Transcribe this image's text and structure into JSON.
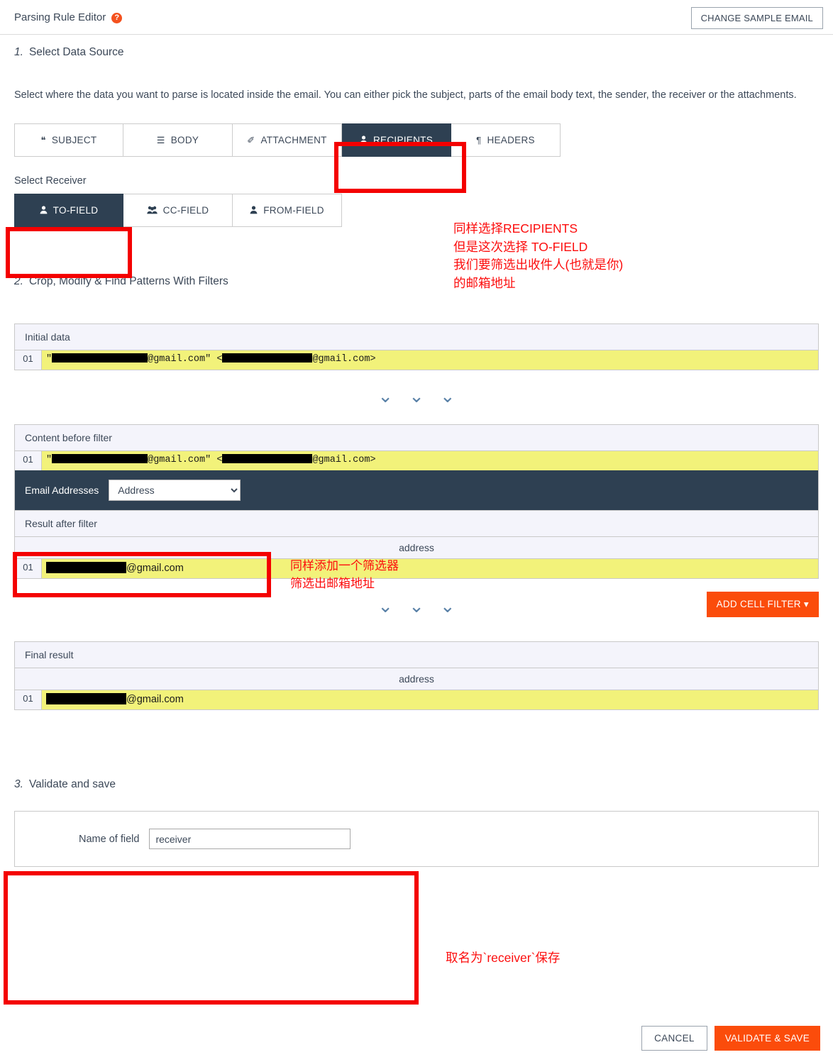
{
  "header": {
    "title": "Parsing Rule Editor",
    "help_icon": "question-mark-icon",
    "change_sample_button": "CHANGE SAMPLE EMAIL"
  },
  "step1": {
    "number": "1.",
    "title": "Select Data Source",
    "description": "Select where the data you want to parse is located inside the email. You can either pick the subject, parts of the email body text, the sender, the receiver or the attachments.",
    "source_tabs": [
      {
        "label": "SUBJECT",
        "icon": "quote-icon",
        "glyph": "❝",
        "active": false
      },
      {
        "label": "BODY",
        "icon": "lines-icon",
        "glyph": "☰",
        "active": false
      },
      {
        "label": "ATTACHMENT",
        "icon": "paperclip-icon",
        "glyph": "✐",
        "active": false
      },
      {
        "label": "RECIPIENTS",
        "icon": "user-icon",
        "glyph": "♟",
        "active": true
      },
      {
        "label": "HEADERS",
        "icon": "pilcrow-icon",
        "glyph": "¶",
        "active": false
      }
    ],
    "receiver_label": "Select Receiver",
    "receiver_tabs": [
      {
        "label": "TO-FIELD",
        "icon": "user-icon",
        "glyph": "♟",
        "active": true
      },
      {
        "label": "CC-FIELD",
        "icon": "users-group-icon",
        "glyph": "♟♟",
        "active": false
      },
      {
        "label": "FROM-FIELD",
        "icon": "user-icon",
        "glyph": "♟",
        "active": false
      }
    ],
    "annotation": "同样选择RECIPIENTS\n但是这次选择 TO-FIELD\n我们要筛选出收件人(也就是你)\n的邮箱地址"
  },
  "step2": {
    "number": "2.",
    "title": "Crop, Modify & Find Patterns With Filters",
    "initial_data": {
      "panel_title": "Initial data",
      "row_number": "01",
      "text_before": "\"",
      "text_mid": "@gmail.com\"  <",
      "text_after": "@gmail.com>"
    },
    "content_before_filter": {
      "panel_title": "Content before filter",
      "row_number": "01",
      "text_before": "\"",
      "text_mid": "@gmail.com\"  <",
      "text_after": "@gmail.com>"
    },
    "filter": {
      "label": "Email Addresses",
      "selected_option": "Address",
      "options": [
        "Address"
      ],
      "annotation": "同样添加一个筛选器\n筛选出邮箱地址"
    },
    "result_after_filter": {
      "panel_title": "Result after filter",
      "column_header": "address",
      "row_number": "01",
      "text_after": "@gmail.com"
    },
    "final_result": {
      "panel_title": "Final result",
      "column_header": "address",
      "row_number": "01",
      "text_after": "@gmail.com"
    },
    "add_cell_filter_button": "ADD CELL FILTER",
    "add_cell_filter_caret": "▾",
    "chevron_glyph": "⌄"
  },
  "step3": {
    "number": "3.",
    "title": "Validate and save",
    "field_label": "Name of field",
    "field_value": "receiver",
    "annotation": "取名为`receiver`保存"
  },
  "footer": {
    "cancel_button": "CANCEL",
    "save_button": "VALIDATE & SAVE"
  },
  "colors": {
    "accent_orange": "#fb4c0b",
    "dark_navy": "#2e4052",
    "highlight_yellow": "#f2f27a",
    "annotation_red": "#fc0d0d",
    "panel_header": "#f4f4fb"
  }
}
